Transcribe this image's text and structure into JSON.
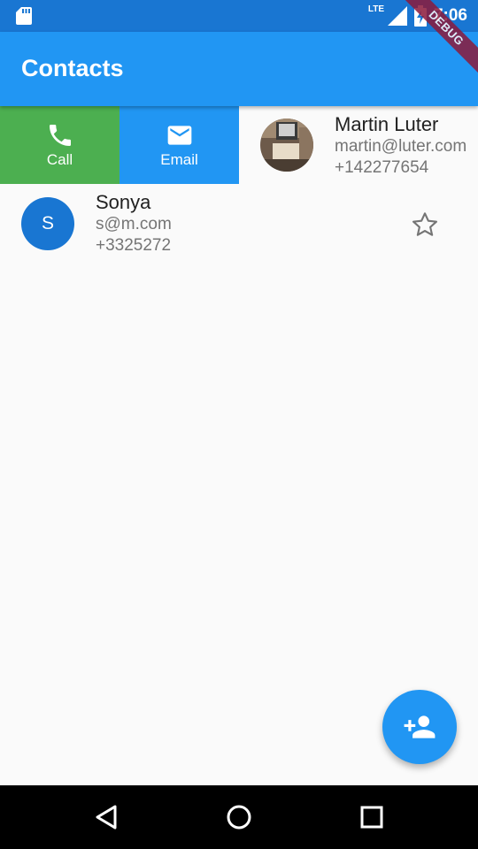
{
  "status_bar": {
    "time": "7:06",
    "network": "LTE",
    "icons": [
      "sd-card-icon",
      "signal-icon",
      "battery-charging-icon"
    ]
  },
  "debug_banner": "DEBUG",
  "app_bar": {
    "title": "Contacts"
  },
  "contacts": [
    {
      "name": "Martin Luter",
      "email": "martin@luter.com",
      "phone": "+142277654",
      "actions": [
        {
          "label": "Call",
          "icon": "phone-icon",
          "color": "#4caf50"
        },
        {
          "label": "Email",
          "icon": "mail-icon",
          "color": "#2196f3"
        }
      ]
    },
    {
      "name": "Sonya",
      "initial": "S",
      "email": "s@m.com",
      "phone": "+3325272",
      "favorite_icon": "star-outline-icon"
    }
  ],
  "fab": {
    "icon": "person-add-icon",
    "color": "#2196f3"
  },
  "nav_bar": {
    "icons": [
      "back-icon",
      "home-icon",
      "recents-icon"
    ]
  },
  "colors": {
    "primary": "#2196f3",
    "primary_dark": "#1976d2",
    "call": "#4caf50"
  }
}
